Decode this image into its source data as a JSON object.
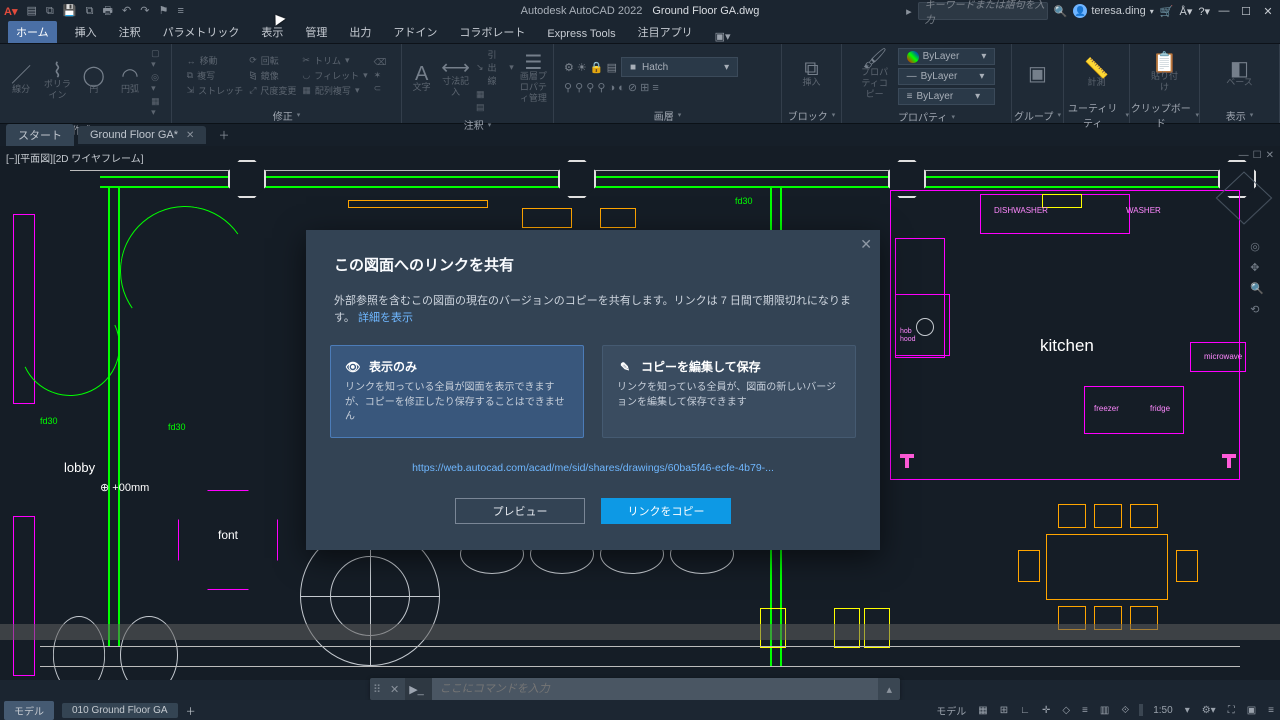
{
  "titlebar": {
    "app": "Autodesk AutoCAD 2022",
    "doc": "Ground Floor  GA.dwg",
    "search_placeholder": "キーワードまたは語句を入力",
    "user": "teresa.ding"
  },
  "tabs": [
    "ホーム",
    "挿入",
    "注釈",
    "パラメトリック",
    "表示",
    "管理",
    "出力",
    "アドイン",
    "コラボレート",
    "Express Tools",
    "注目アプリ"
  ],
  "panels": {
    "create": {
      "label": "作成",
      "items": [
        "線分",
        "ポリライン",
        "円",
        "円弧"
      ]
    },
    "modify": {
      "label": "修正",
      "items": [
        "移動",
        "回転",
        "トリム",
        "複写",
        "鏡像",
        "フィレット",
        "ストレッチ",
        "尺度変更",
        "配列複写"
      ]
    },
    "annot": {
      "label": "注釈",
      "items": [
        "文字",
        "寸法記入",
        "引出線",
        "画層プロパティ管理"
      ]
    },
    "layer": {
      "label": "画層",
      "hatch": "Hatch"
    },
    "block": {
      "label": "ブロック",
      "items": [
        "挿入",
        "プロパティコピー"
      ]
    },
    "props": {
      "label": "プロパティ",
      "bylayer": "ByLayer"
    },
    "group": {
      "label": "グループ"
    },
    "utility": {
      "label": "ユーティリティ",
      "item": "計測"
    },
    "clipboard": {
      "label": "クリップボード",
      "item": "貼り付け"
    },
    "view": {
      "label": "表示",
      "item": "ベース"
    }
  },
  "doctabs": {
    "start": "スタート",
    "active": "Ground Floor  GA*"
  },
  "viewport": {
    "label": "[−][平面図][2D ワイヤフレーム]"
  },
  "drawing": {
    "lobby": "lobby",
    "kitchen": "kitchen",
    "font": "font",
    "dishwasher": "DISHWASHER",
    "washer": "WASHER",
    "microwave": "microwave",
    "freezer": "freezer",
    "fridge": "fridge",
    "hob": "hob",
    "hood": "hood",
    "origin": "+00mm",
    "fd30a": "fd30",
    "fd30b": "fd30",
    "fd30c": "fd30"
  },
  "modal": {
    "title": "この図面へのリンクを共有",
    "desc_a": "外部参照を含むこの図面の現在のバージョンのコピーを共有します。リンクは 7 日間で期限切れになります。",
    "desc_link": "詳細を表示",
    "card1_title": "表示のみ",
    "card1_body": "リンクを知っている全員が図面を表示できますが、コピーを修正したり保存することはできません",
    "card2_title": "コピーを編集して保存",
    "card2_body": "リンクを知っている全員が、図面の新しいバージョンを編集して保存できます",
    "url": "https://web.autocad.com/acad/me/sid/shares/drawings/60ba5f46-ecfe-4b79-...",
    "btn_preview": "プレビュー",
    "btn_copy": "リンクをコピー"
  },
  "cmd": {
    "placeholder": "ここにコマンドを入力"
  },
  "status": {
    "model_tab": "モデル",
    "layout_tab": "010 Ground Floor GA",
    "model": "モデル",
    "scale": "1:50"
  }
}
